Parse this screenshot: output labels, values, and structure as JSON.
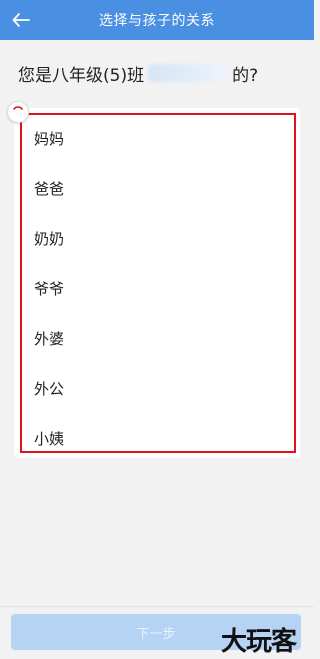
{
  "header": {
    "back_icon": "arrow-left-icon",
    "title": "选择与孩子的关系"
  },
  "question": {
    "prefix": "您是八年级(5)班",
    "suffix": "的?"
  },
  "relations": [
    "妈妈",
    "爸爸",
    "奶奶",
    "爷爷",
    "外婆",
    "外公",
    "小姨"
  ],
  "footer": {
    "next_label": "下一步"
  },
  "watermark": "大玩客",
  "colors": {
    "header": "#4a90e2",
    "highlight_frame": "#e1111a",
    "button_disabled": "#b7d3f3"
  }
}
